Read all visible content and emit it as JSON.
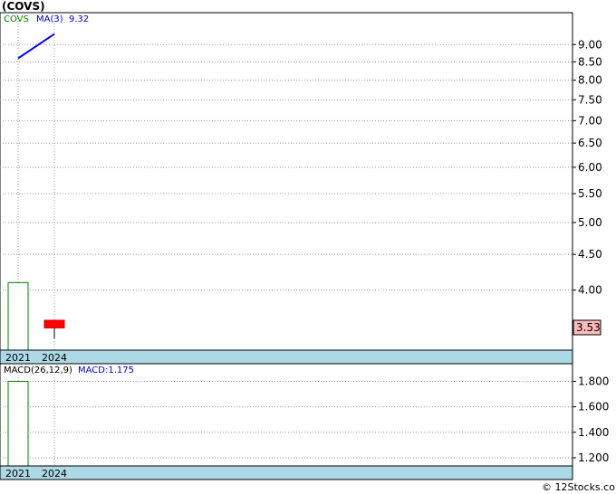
{
  "title": "(COVS)",
  "watermark": "© 12Stocks.com",
  "colors": {
    "legend_ticker": "#008000",
    "legend_ma": "#0000cc",
    "ma_line": "#0000ff",
    "up_candle_border": "#008000",
    "down_candle": "#ff0000",
    "date_bar": "#add8e6",
    "grid": "#999999",
    "price_label_bg": "#ffbbbb"
  },
  "chart_data": [
    {
      "type": "candlestick",
      "categories": [
        "2021",
        "2024"
      ],
      "legend": {
        "ticker": "COVS",
        "ma_label": "MA(3)",
        "ma_value": "9.32"
      },
      "yticks": [
        "9.00",
        "8.50",
        "8.00",
        "7.50",
        "7.00",
        "6.50",
        "6.00",
        "5.50",
        "5.00",
        "4.50",
        "4.00"
      ],
      "y_scale": "log",
      "ylim": [
        3.28,
        10.0
      ],
      "grid": true,
      "candles": [
        {
          "x": "2021",
          "open": 3.28,
          "close": 4.1,
          "high": 4.1,
          "low": 3.28,
          "direction": "up"
        },
        {
          "x": "2024",
          "open": 3.62,
          "close": 3.53,
          "high": 3.62,
          "low": 3.41,
          "direction": "down"
        }
      ],
      "ma_series": {
        "name": "MA(3)",
        "points": [
          {
            "x": "2021",
            "y": 8.6
          },
          {
            "x": "2024",
            "y": 9.32
          }
        ]
      },
      "last_price_label": "3.53",
      "last_price": 3.53
    },
    {
      "type": "bar",
      "categories": [
        "2021",
        "2024"
      ],
      "legend": {
        "name": "MACD(26,12,9)",
        "value_label": "MACD:1.175"
      },
      "yticks": [
        "1.800",
        "1.600",
        "1.400",
        "1.200"
      ],
      "ylim": [
        1.136,
        1.938
      ],
      "grid": true,
      "bars": [
        {
          "x": "2021",
          "value": 1.8
        }
      ]
    }
  ]
}
